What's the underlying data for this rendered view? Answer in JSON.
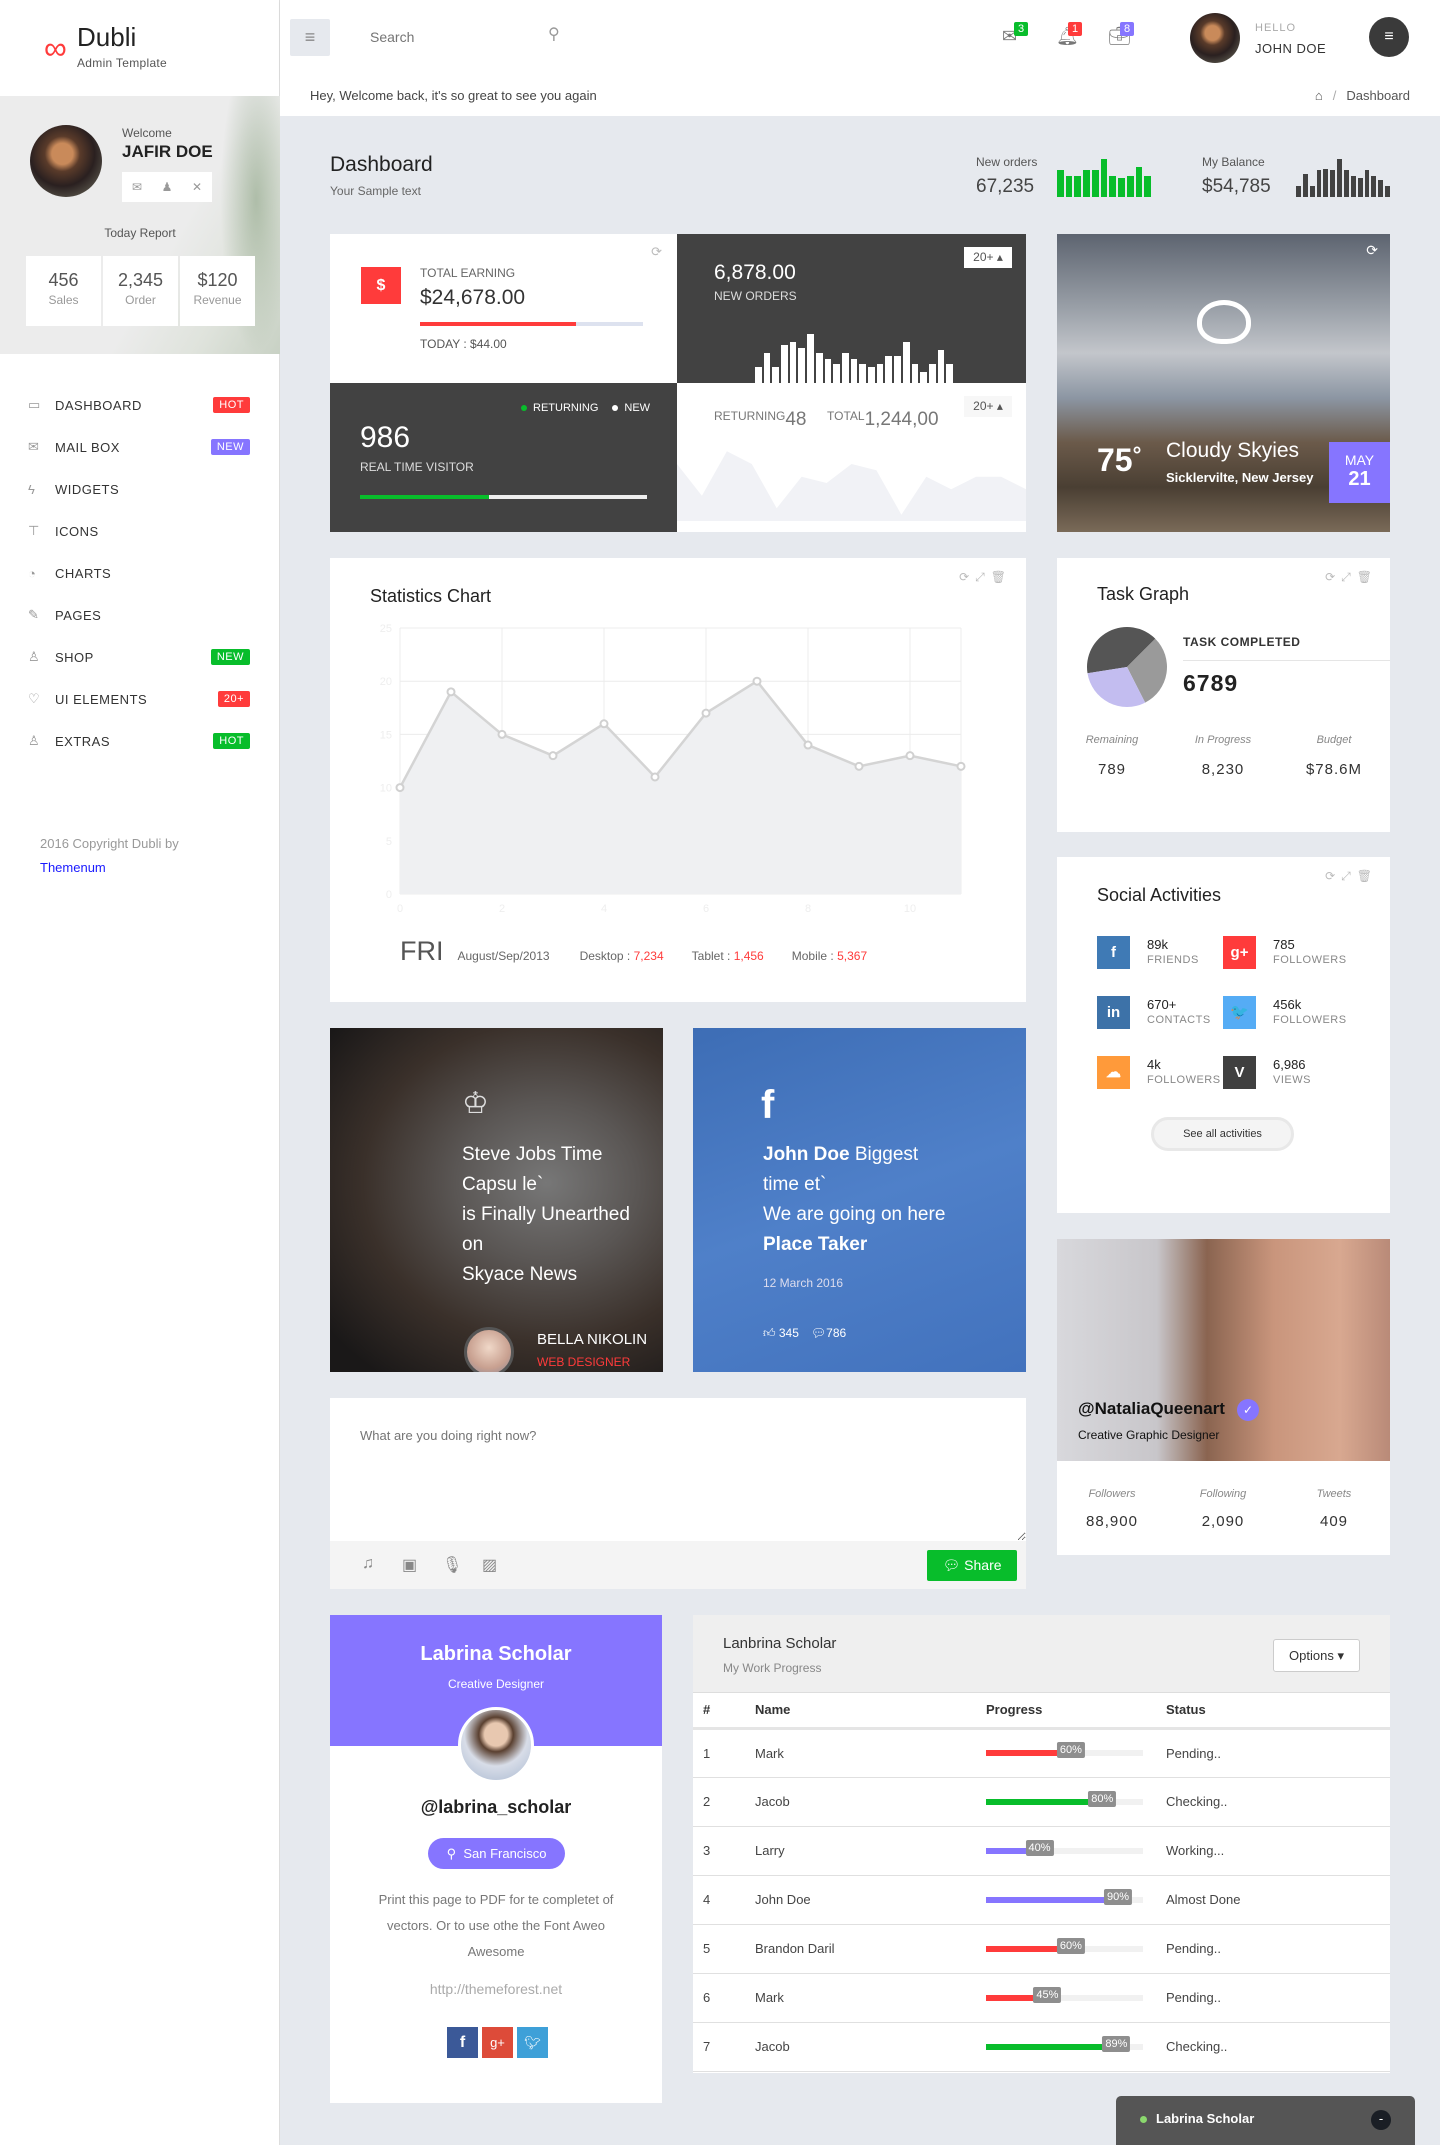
{
  "brand": {
    "name": "Dubli",
    "subtitle": "Admin Template",
    "accent": "#ff3b3b"
  },
  "user_panel": {
    "welcome": "Welcome",
    "name": "JAFIR DOE",
    "today_report": "Today Report",
    "report": [
      {
        "value": "456",
        "label": "Sales"
      },
      {
        "value": "2,345",
        "label": "Order"
      },
      {
        "value": "$120",
        "label": "Revenue"
      }
    ]
  },
  "sidebar": {
    "items": [
      {
        "label": "DASHBOARD",
        "icon": "monitor-icon",
        "glyph": "▭",
        "badge": "HOT",
        "badge_color": "#ff3b3b"
      },
      {
        "label": "MAIL BOX",
        "icon": "mail-icon",
        "glyph": "✉",
        "badge": "NEW",
        "badge_color": "#8675ff"
      },
      {
        "label": "WIDGETS",
        "icon": "bolt-icon",
        "glyph": "ϟ",
        "badge": "",
        "badge_color": ""
      },
      {
        "label": "ICONS",
        "icon": "paint-roller-icon",
        "glyph": "⊤",
        "badge": "",
        "badge_color": ""
      },
      {
        "label": "CHARTS",
        "icon": "pie-chart-icon",
        "glyph": "◔",
        "badge": "",
        "badge_color": ""
      },
      {
        "label": "PAGES",
        "icon": "pencil-icon",
        "glyph": "✎",
        "badge": "",
        "badge_color": ""
      },
      {
        "label": "SHOP",
        "icon": "flask-icon",
        "glyph": "♙",
        "badge": "NEW",
        "badge_color": "#08bd2b"
      },
      {
        "label": "UI ELEMENTS",
        "icon": "heart-icon",
        "glyph": "♡",
        "badge": "20+",
        "badge_color": "#ff3b3b"
      },
      {
        "label": "EXTRAS",
        "icon": "flask-icon",
        "glyph": "♙",
        "badge": "HOT",
        "badge_color": "#08bd2b"
      }
    ],
    "copyright": "2016 Copyright Dubli by",
    "copyright_link": "Themenum"
  },
  "header": {
    "search_placeholder": "Search",
    "notifications": [
      {
        "icon": "mail-icon",
        "count": "3",
        "color": "#08bd2b"
      },
      {
        "icon": "bell-icon",
        "count": "1",
        "color": "#ff3b3b"
      },
      {
        "icon": "briefcase-icon",
        "count": "8",
        "color": "#8675ff"
      }
    ],
    "hello": "HELLO",
    "user": "JOHN DOE"
  },
  "welcome_text": "Hey, Welcome back, it's so great to see you again",
  "breadcrumb": {
    "sep": "/",
    "current": "Dashboard"
  },
  "page": {
    "title": "Dashboard",
    "subtitle": "Your Sample text"
  },
  "header_stats": [
    {
      "label": "New orders",
      "value": "67,235",
      "color": "#08bd2b",
      "bars": [
        7,
        5.5,
        5.5,
        7,
        7,
        10,
        5.5,
        5,
        5.5,
        8,
        5.5
      ]
    },
    {
      "label": "My Balance",
      "value": "$54,785",
      "color": "#424242",
      "bars": [
        3,
        6,
        3,
        7,
        7.5,
        7,
        10,
        7,
        5.5,
        5,
        7,
        5.5,
        4.5,
        3
      ]
    }
  ],
  "earning": {
    "label": "TOTAL EARNING",
    "value": "$24,678.00",
    "progress": 70,
    "today": "TODAY : $44.00",
    "icon_label": "$"
  },
  "orders": {
    "value": "6,878.00",
    "label": "NEW ORDERS",
    "badge": "20+",
    "bars": [
      3,
      5.5,
      3,
      7,
      7.5,
      6.5,
      9,
      5.5,
      4.5,
      3.5,
      5.5,
      4.5,
      3.5,
      3,
      3.5,
      5,
      5,
      7.5,
      3.5,
      2,
      3.5,
      6,
      3.5
    ]
  },
  "visitors": {
    "value": "986",
    "label": "REAL TIME VISITOR",
    "legend_returning": "RETURNING",
    "legend_new": "NEW",
    "progress": 45
  },
  "returning": {
    "returning_label": "RETURNING",
    "returning_value": "48",
    "total_label": "TOTAL",
    "total_value": "1,244,00",
    "badge": "20+",
    "area": [
      9,
      4,
      11,
      9,
      2,
      7,
      6,
      9,
      8,
      1,
      7,
      5,
      7,
      7,
      5
    ]
  },
  "weather": {
    "temp": "75",
    "deg": "°",
    "condition": "Cloudy Skyies",
    "location": "Sicklervilte, New Jersey",
    "month": "MAY",
    "day": "21"
  },
  "stats_chart": {
    "title": "Statistics Chart",
    "day": "FRI",
    "date": "August/Sep/2013",
    "desktop_label": "Desktop :",
    "desktop": "7,234",
    "tablet_label": "Tablet :",
    "tablet": "1,456",
    "mobile_label": "Mobile :",
    "mobile": "5,367"
  },
  "chart_data": {
    "type": "area",
    "x": [
      0,
      1,
      2,
      3,
      4,
      5,
      6,
      7,
      8,
      9,
      10,
      11
    ],
    "values": [
      10,
      19,
      15,
      13,
      16,
      11,
      17,
      20,
      14,
      12,
      13,
      12
    ],
    "xlim": [
      0,
      11
    ],
    "ylim": [
      0,
      25
    ],
    "xticks": [
      "0",
      "2",
      "4",
      "6",
      "8",
      "10"
    ],
    "yticks": [
      "0",
      "5",
      "10",
      "15",
      "20",
      "25"
    ],
    "grid": true
  },
  "task_graph": {
    "title": "Task Graph",
    "completed_label": "TASK COMPLETED",
    "completed": "6789",
    "pie": [
      {
        "value": 40,
        "color": "#555555"
      },
      {
        "value": 30,
        "color": "#9a9a9a"
      },
      {
        "value": 30,
        "color": "#c3bdf0"
      }
    ],
    "stats": [
      {
        "label": "Remaining",
        "value": "789"
      },
      {
        "label": "In Progress",
        "value": "8,230"
      },
      {
        "label": "Budget",
        "value": "$78.6M"
      }
    ]
  },
  "social": {
    "title": "Social Activities",
    "items": [
      {
        "icon": "facebook-icon",
        "glyph": "f",
        "color": "#3f7ab5",
        "value": "89k",
        "label": "FRIENDS"
      },
      {
        "icon": "google-plus-icon",
        "glyph": "g+",
        "color": "#ff3b3b",
        "value": "785",
        "label": "FOLLOWERS"
      },
      {
        "icon": "linkedin-icon",
        "glyph": "in",
        "color": "#3d72a8",
        "value": "670+",
        "label": "CONTACTS"
      },
      {
        "icon": "twitter-icon",
        "glyph": "🐦",
        "color": "#55acf5",
        "value": "456k",
        "label": "FOLLOWERS"
      },
      {
        "icon": "soundcloud-icon",
        "glyph": "☁",
        "color": "#ff9a3a",
        "value": "4k",
        "label": "FOLLOWERS"
      },
      {
        "icon": "vine-icon",
        "glyph": "V",
        "color": "#404040",
        "value": "6,986",
        "label": "VIEWS"
      }
    ],
    "see_all": "See all activities"
  },
  "blog1": {
    "bold1": "Steve Jobs",
    "t1": " Time",
    "t2": "Capsu le`",
    "t3": "is Finally Unearthed",
    "t4": "on",
    "bold2": "Skyace News",
    "author": "BELLA NIKOLIN",
    "role": "WEB DESIGNER"
  },
  "blog2": {
    "bold1": "John Doe",
    "t1": " Biggest",
    "t2": "time et`",
    "t3": "We are going on here",
    "bold2": "Place Taker",
    "date": "12 March 2016",
    "likes": "345",
    "comments": "786"
  },
  "profile": {
    "handle": "@NataliaQueenart",
    "role": "Creative Graphic Designer",
    "stats": [
      {
        "label": "Followers",
        "value": "88,900"
      },
      {
        "label": "Following",
        "value": "2,090"
      },
      {
        "label": "Tweets",
        "value": "409"
      }
    ]
  },
  "post": {
    "placeholder": "What are you doing right now?",
    "share": "Share"
  },
  "card": {
    "name": "Labrina Scholar",
    "role": "Creative Designer",
    "handle": "@labrina_scholar",
    "location": "San Francisco",
    "bio1": "Print this page to PDF for te completet of",
    "bio2": "vectors. Or to use othe the Font Aweo",
    "bio3": "Awesome",
    "url": "http://themeforest.net",
    "accent": "#8675ff"
  },
  "work": {
    "title": "Lanbrina Scholar",
    "subtitle": "My Work Progress",
    "options": "Options",
    "columns": [
      "#",
      "Name",
      "Progress",
      "Status"
    ],
    "rows": [
      {
        "n": "1",
        "name": "Mark",
        "progress": 60,
        "label": "60%",
        "color": "#ff3b3b",
        "status": "Pending.."
      },
      {
        "n": "2",
        "name": "Jacob",
        "progress": 80,
        "label": "80%",
        "color": "#08bd2b",
        "status": "Checking.."
      },
      {
        "n": "3",
        "name": "Larry",
        "progress": 40,
        "label": "40%",
        "color": "#8675ff",
        "status": "Working..."
      },
      {
        "n": "4",
        "name": "John Doe",
        "progress": 90,
        "label": "90%",
        "color": "#8675ff",
        "status": "Almost Done"
      },
      {
        "n": "5",
        "name": "Brandon Daril",
        "progress": 60,
        "label": "60%",
        "color": "#ff3b3b",
        "status": "Pending.."
      },
      {
        "n": "6",
        "name": "Mark",
        "progress": 45,
        "label": "45%",
        "color": "#ff3b3b",
        "status": "Pending.."
      },
      {
        "n": "7",
        "name": "Jacob",
        "progress": 89,
        "label": "89%",
        "color": "#08bd2b",
        "status": "Checking.."
      }
    ]
  },
  "chat": {
    "name": "Labrina Scholar",
    "minimize": "-"
  }
}
